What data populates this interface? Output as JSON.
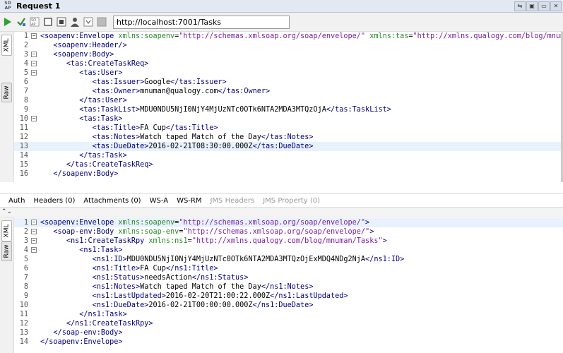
{
  "window": {
    "title": "Request 1",
    "logo_text": "SO AP",
    "buttons": [
      "⇆",
      "▣",
      "▭",
      "✕"
    ]
  },
  "toolbar": {
    "endpoint": "http://localhost:7001/Tasks",
    "icons": [
      "play-icon",
      "add-assertion-icon",
      "ws-security-icon",
      "stop-icon",
      "options-icon",
      "user-icon",
      "move-down-icon",
      "cancel-icon"
    ]
  },
  "side_tabs": {
    "xml": "XML",
    "raw": "Raw"
  },
  "request": [
    {
      "n": "1",
      "fold": "−",
      "parts": [
        [
          "br",
          "<"
        ],
        [
          "tag",
          "soapenv:Envelope"
        ],
        [
          "t",
          " "
        ],
        [
          "attr",
          "xmlns:soapenv"
        ],
        [
          "t",
          "="
        ],
        [
          "val",
          "\"http://schemas.xmlsoap.org/soap/envelope/\""
        ],
        [
          "t",
          " "
        ],
        [
          "attr",
          "xmlns:tas"
        ],
        [
          "t",
          "="
        ],
        [
          "val",
          "\"http://xmlns.qualogy.com/blog/mnuman/Tasks\""
        ],
        [
          "br",
          ">"
        ]
      ]
    },
    {
      "n": "2",
      "fold": "",
      "parts": [
        [
          "t",
          "   "
        ],
        [
          "br",
          "<"
        ],
        [
          "tag",
          "soapenv:Header"
        ],
        [
          "br",
          "/>"
        ]
      ]
    },
    {
      "n": "3",
      "fold": "−",
      "parts": [
        [
          "t",
          "   "
        ],
        [
          "br",
          "<"
        ],
        [
          "tag",
          "soapenv:Body"
        ],
        [
          "br",
          ">"
        ]
      ]
    },
    {
      "n": "4",
      "fold": "−",
      "parts": [
        [
          "t",
          "      "
        ],
        [
          "br",
          "<"
        ],
        [
          "tag",
          "tas:CreateTaskReq"
        ],
        [
          "br",
          ">"
        ]
      ]
    },
    {
      "n": "5",
      "fold": "−",
      "parts": [
        [
          "t",
          "         "
        ],
        [
          "br",
          "<"
        ],
        [
          "tag",
          "tas:User"
        ],
        [
          "br",
          ">"
        ]
      ]
    },
    {
      "n": "6",
      "fold": "",
      "parts": [
        [
          "t",
          "            "
        ],
        [
          "br",
          "<"
        ],
        [
          "tag",
          "tas:Issuer"
        ],
        [
          "br",
          ">"
        ],
        [
          "t",
          "Google"
        ],
        [
          "br",
          "</"
        ],
        [
          "tag",
          "tas:Issuer"
        ],
        [
          "br",
          ">"
        ]
      ]
    },
    {
      "n": "7",
      "fold": "",
      "parts": [
        [
          "t",
          "            "
        ],
        [
          "br",
          "<"
        ],
        [
          "tag",
          "tas:Owner"
        ],
        [
          "br",
          ">"
        ],
        [
          "t",
          "mnuman@qualogy.com"
        ],
        [
          "br",
          "</"
        ],
        [
          "tag",
          "tas:Owner"
        ],
        [
          "br",
          ">"
        ]
      ]
    },
    {
      "n": "8",
      "fold": "",
      "parts": [
        [
          "t",
          "         "
        ],
        [
          "br",
          "</"
        ],
        [
          "tag",
          "tas:User"
        ],
        [
          "br",
          ">"
        ]
      ]
    },
    {
      "n": "9",
      "fold": "",
      "parts": [
        [
          "t",
          "         "
        ],
        [
          "br",
          "<"
        ],
        [
          "tag",
          "tas:TaskList"
        ],
        [
          "br",
          ">"
        ],
        [
          "t",
          "MDU0NDU5NjI0NjY4MjUzNTc0OTk6NTA2MDA3MTQzOjA"
        ],
        [
          "br",
          "</"
        ],
        [
          "tag",
          "tas:TaskList"
        ],
        [
          "br",
          ">"
        ]
      ]
    },
    {
      "n": "10",
      "fold": "−",
      "parts": [
        [
          "t",
          "         "
        ],
        [
          "br",
          "<"
        ],
        [
          "tag",
          "tas:Task"
        ],
        [
          "br",
          ">"
        ]
      ]
    },
    {
      "n": "11",
      "fold": "",
      "parts": [
        [
          "t",
          "            "
        ],
        [
          "br",
          "<"
        ],
        [
          "tag",
          "tas:Title"
        ],
        [
          "br",
          ">"
        ],
        [
          "t",
          "FA Cup"
        ],
        [
          "br",
          "</"
        ],
        [
          "tag",
          "tas:Title"
        ],
        [
          "br",
          ">"
        ]
      ]
    },
    {
      "n": "12",
      "fold": "",
      "parts": [
        [
          "t",
          "            "
        ],
        [
          "br",
          "<"
        ],
        [
          "tag",
          "tas:Notes"
        ],
        [
          "br",
          ">"
        ],
        [
          "t",
          "Watch taped Match of the Day"
        ],
        [
          "br",
          "</"
        ],
        [
          "tag",
          "tas:Notes"
        ],
        [
          "br",
          ">"
        ]
      ]
    },
    {
      "n": "13",
      "fold": "",
      "hl": true,
      "parts": [
        [
          "t",
          "            "
        ],
        [
          "br",
          "<"
        ],
        [
          "tag",
          "tas:DueDate"
        ],
        [
          "br",
          ">"
        ],
        [
          "t",
          "2016-02-21T08:30:00.000Z"
        ],
        [
          "br",
          "</"
        ],
        [
          "tag",
          "tas:DueDate"
        ],
        [
          "br",
          ">"
        ]
      ]
    },
    {
      "n": "14",
      "fold": "",
      "parts": [
        [
          "t",
          "         "
        ],
        [
          "br",
          "</"
        ],
        [
          "tag",
          "tas:Task"
        ],
        [
          "br",
          ">"
        ]
      ]
    },
    {
      "n": "15",
      "fold": "",
      "parts": [
        [
          "t",
          "      "
        ],
        [
          "br",
          "</"
        ],
        [
          "tag",
          "tas:CreateTaskReq"
        ],
        [
          "br",
          ">"
        ]
      ]
    },
    {
      "n": "16",
      "fold": "",
      "parts": [
        [
          "t",
          "   "
        ],
        [
          "br",
          "</"
        ],
        [
          "tag",
          "soapenv:Body"
        ],
        [
          "br",
          ">"
        ]
      ]
    }
  ],
  "tabs": [
    {
      "label": "Auth",
      "disabled": false
    },
    {
      "label": "Headers (0)",
      "disabled": false
    },
    {
      "label": "Attachments (0)",
      "disabled": false
    },
    {
      "label": "WS-A",
      "disabled": false
    },
    {
      "label": "WS-RM",
      "disabled": false
    },
    {
      "label": "JMS Headers",
      "disabled": true
    },
    {
      "label": "JMS Property (0)",
      "disabled": true
    }
  ],
  "splitter": "⌃⌄",
  "response": [
    {
      "n": "1",
      "fold": "−",
      "hl": true,
      "parts": [
        [
          "br",
          "<"
        ],
        [
          "tag",
          "soapenv:Envelope"
        ],
        [
          "t",
          " "
        ],
        [
          "attr",
          "xmlns:soapenv"
        ],
        [
          "t",
          "="
        ],
        [
          "val",
          "\"http://schemas.xmlsoap.org/soap/envelope/\""
        ],
        [
          "br",
          ">"
        ]
      ]
    },
    {
      "n": "2",
      "fold": "−",
      "parts": [
        [
          "t",
          "   "
        ],
        [
          "br",
          "<"
        ],
        [
          "tag",
          "soap-env:Body"
        ],
        [
          "t",
          " "
        ],
        [
          "attr",
          "xmlns:soap-env"
        ],
        [
          "t",
          "="
        ],
        [
          "val",
          "\"http://schemas.xmlsoap.org/soap/envelope/\""
        ],
        [
          "br",
          ">"
        ]
      ]
    },
    {
      "n": "3",
      "fold": "−",
      "parts": [
        [
          "t",
          "      "
        ],
        [
          "br",
          "<"
        ],
        [
          "tag",
          "ns1:CreateTaskRpy"
        ],
        [
          "t",
          " "
        ],
        [
          "attr",
          "xmlns:ns1"
        ],
        [
          "t",
          "="
        ],
        [
          "val",
          "\"http://xmlns.qualogy.com/blog/mnuman/Tasks\""
        ],
        [
          "br",
          ">"
        ]
      ]
    },
    {
      "n": "4",
      "fold": "−",
      "parts": [
        [
          "t",
          "         "
        ],
        [
          "br",
          "<"
        ],
        [
          "tag",
          "ns1:Task"
        ],
        [
          "br",
          ">"
        ]
      ]
    },
    {
      "n": "5",
      "fold": "",
      "parts": [
        [
          "t",
          "            "
        ],
        [
          "br",
          "<"
        ],
        [
          "tag",
          "ns1:ID"
        ],
        [
          "br",
          ">"
        ],
        [
          "t",
          "MDU0NDU5NjI0NjY4MjUzNTc0OTk6NTA2MDA3MTQzOjExMDQ4NDg2NjA"
        ],
        [
          "br",
          "</"
        ],
        [
          "tag",
          "ns1:ID"
        ],
        [
          "br",
          ">"
        ]
      ]
    },
    {
      "n": "6",
      "fold": "",
      "parts": [
        [
          "t",
          "            "
        ],
        [
          "br",
          "<"
        ],
        [
          "tag",
          "ns1:Title"
        ],
        [
          "br",
          ">"
        ],
        [
          "t",
          "FA Cup"
        ],
        [
          "br",
          "</"
        ],
        [
          "tag",
          "ns1:Title"
        ],
        [
          "br",
          ">"
        ]
      ]
    },
    {
      "n": "7",
      "fold": "",
      "parts": [
        [
          "t",
          "            "
        ],
        [
          "br",
          "<"
        ],
        [
          "tag",
          "ns1:Status"
        ],
        [
          "br",
          ">"
        ],
        [
          "t",
          "needsAction"
        ],
        [
          "br",
          "</"
        ],
        [
          "tag",
          "ns1:Status"
        ],
        [
          "br",
          ">"
        ]
      ]
    },
    {
      "n": "8",
      "fold": "",
      "parts": [
        [
          "t",
          "            "
        ],
        [
          "br",
          "<"
        ],
        [
          "tag",
          "ns1:Notes"
        ],
        [
          "br",
          ">"
        ],
        [
          "t",
          "Watch taped Match of the Day"
        ],
        [
          "br",
          "</"
        ],
        [
          "tag",
          "ns1:Notes"
        ],
        [
          "br",
          ">"
        ]
      ]
    },
    {
      "n": "9",
      "fold": "",
      "parts": [
        [
          "t",
          "            "
        ],
        [
          "br",
          "<"
        ],
        [
          "tag",
          "ns1:LastUpdated"
        ],
        [
          "br",
          ">"
        ],
        [
          "t",
          "2016-02-20T21:00:22.000Z"
        ],
        [
          "br",
          "</"
        ],
        [
          "tag",
          "ns1:LastUpdated"
        ],
        [
          "br",
          ">"
        ]
      ]
    },
    {
      "n": "10",
      "fold": "",
      "parts": [
        [
          "t",
          "            "
        ],
        [
          "br",
          "<"
        ],
        [
          "tag",
          "ns1:DueDate"
        ],
        [
          "br",
          ">"
        ],
        [
          "t",
          "2016-02-21T00:00:00.000Z"
        ],
        [
          "br",
          "</"
        ],
        [
          "tag",
          "ns1:DueDate"
        ],
        [
          "br",
          ">"
        ]
      ]
    },
    {
      "n": "11",
      "fold": "",
      "parts": [
        [
          "t",
          "         "
        ],
        [
          "br",
          "</"
        ],
        [
          "tag",
          "ns1:Task"
        ],
        [
          "br",
          ">"
        ]
      ]
    },
    {
      "n": "12",
      "fold": "",
      "parts": [
        [
          "t",
          "      "
        ],
        [
          "br",
          "</"
        ],
        [
          "tag",
          "ns1:CreateTaskRpy"
        ],
        [
          "br",
          ">"
        ]
      ]
    },
    {
      "n": "13",
      "fold": "",
      "parts": [
        [
          "t",
          "   "
        ],
        [
          "br",
          "</"
        ],
        [
          "tag",
          "soap-env:Body"
        ],
        [
          "br",
          ">"
        ]
      ]
    },
    {
      "n": "14",
      "fold": "",
      "parts": [
        [
          "br",
          "</"
        ],
        [
          "tag",
          "soapenv:Envelope"
        ],
        [
          "br",
          ">"
        ]
      ]
    }
  ]
}
